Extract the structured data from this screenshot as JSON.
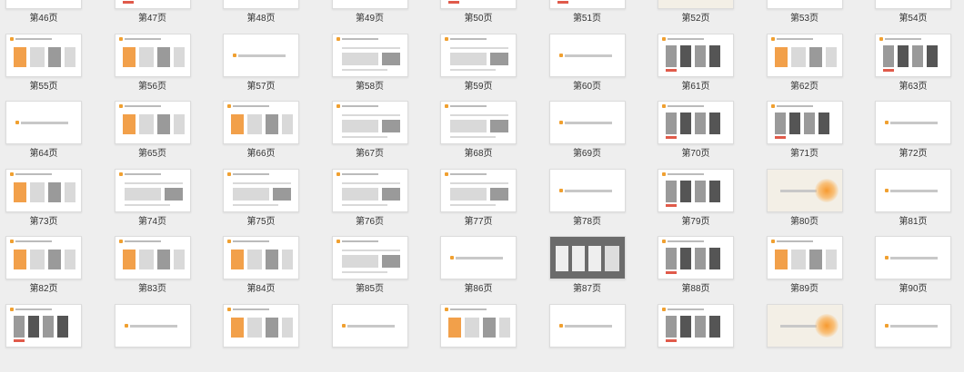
{
  "pages": [
    {
      "label": "第46页",
      "kind": "mixed"
    },
    {
      "label": "第47页",
      "kind": "phones"
    },
    {
      "label": "第48页",
      "kind": "title"
    },
    {
      "label": "第49页",
      "kind": "mixed"
    },
    {
      "label": "第50页",
      "kind": "phones"
    },
    {
      "label": "第51页",
      "kind": "phones"
    },
    {
      "label": "第52页",
      "kind": "glow"
    },
    {
      "label": "第53页",
      "kind": "mixed"
    },
    {
      "label": "第54页",
      "kind": "title"
    },
    {
      "label": "第55页",
      "kind": "mixed"
    },
    {
      "label": "第56页",
      "kind": "mixed"
    },
    {
      "label": "第57页",
      "kind": "title"
    },
    {
      "label": "第58页",
      "kind": "doc"
    },
    {
      "label": "第59页",
      "kind": "doc"
    },
    {
      "label": "第60页",
      "kind": "title"
    },
    {
      "label": "第61页",
      "kind": "phones"
    },
    {
      "label": "第62页",
      "kind": "mixed"
    },
    {
      "label": "第63页",
      "kind": "phones"
    },
    {
      "label": "第64页",
      "kind": "title"
    },
    {
      "label": "第65页",
      "kind": "mixed"
    },
    {
      "label": "第66页",
      "kind": "mixed"
    },
    {
      "label": "第67页",
      "kind": "doc"
    },
    {
      "label": "第68页",
      "kind": "doc"
    },
    {
      "label": "第69页",
      "kind": "title"
    },
    {
      "label": "第70页",
      "kind": "phones"
    },
    {
      "label": "第71页",
      "kind": "phones"
    },
    {
      "label": "第72页",
      "kind": "title"
    },
    {
      "label": "第73页",
      "kind": "mixed"
    },
    {
      "label": "第74页",
      "kind": "doc"
    },
    {
      "label": "第75页",
      "kind": "doc"
    },
    {
      "label": "第76页",
      "kind": "doc"
    },
    {
      "label": "第77页",
      "kind": "doc"
    },
    {
      "label": "第78页",
      "kind": "title"
    },
    {
      "label": "第79页",
      "kind": "phones"
    },
    {
      "label": "第80页",
      "kind": "glow"
    },
    {
      "label": "第81页",
      "kind": "title"
    },
    {
      "label": "第82页",
      "kind": "mixed"
    },
    {
      "label": "第83页",
      "kind": "mixed"
    },
    {
      "label": "第84页",
      "kind": "mixed"
    },
    {
      "label": "第85页",
      "kind": "doc"
    },
    {
      "label": "第86页",
      "kind": "title"
    },
    {
      "label": "第87页",
      "kind": "gray"
    },
    {
      "label": "第88页",
      "kind": "phones"
    },
    {
      "label": "第89页",
      "kind": "mixed"
    },
    {
      "label": "第90页",
      "kind": "title"
    },
    {
      "label": "",
      "kind": "phones"
    },
    {
      "label": "",
      "kind": "title"
    },
    {
      "label": "",
      "kind": "mixed"
    },
    {
      "label": "",
      "kind": "title"
    },
    {
      "label": "",
      "kind": "mixed"
    },
    {
      "label": "",
      "kind": "title"
    },
    {
      "label": "",
      "kind": "phones"
    },
    {
      "label": "",
      "kind": "glow"
    },
    {
      "label": "",
      "kind": "title"
    }
  ]
}
